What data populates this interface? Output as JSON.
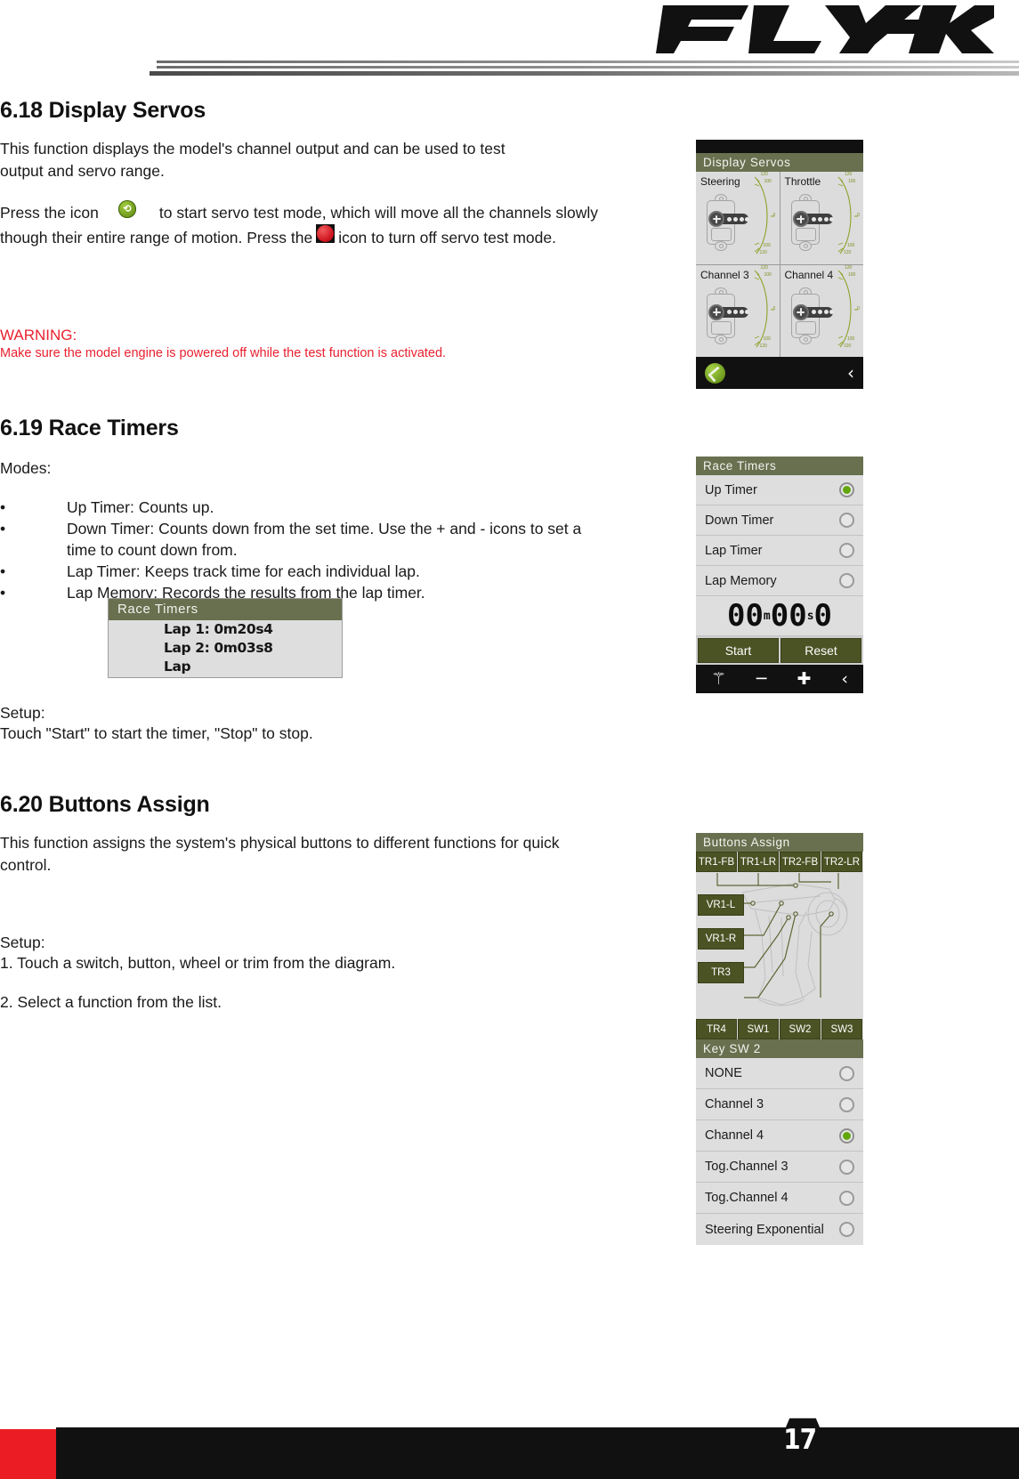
{
  "header": {
    "logo_text": "FLYSKY"
  },
  "sections": {
    "display_servos": {
      "heading": "6.18 Display Servos",
      "para1_line1": "This function displays the model's channel output and can be used to test",
      "para1_line2": "output and servo range.",
      "para2_a": "Press the icon",
      "para2_b": "to start servo test mode, which will move all the channels slowly",
      "para2_c": "though their entire range of motion. Press the",
      "para2_d": "icon to turn off servo test mode.",
      "warning_title": "WARNING:",
      "warning_body": "Make sure the model engine is powered off while the test function is activated."
    },
    "race_timers": {
      "heading": "6.19 Race Timers",
      "modes_label": "Modes:",
      "bullets": [
        {
          "mark": "•",
          "text": "Up Timer: Counts up."
        },
        {
          "mark": "•",
          "text": "Down Timer: Counts down from the set time. Use the + and - icons to set a"
        },
        {
          "mark": "",
          "text": "time to count down from."
        },
        {
          "mark": "•",
          "text": "Lap Timer: Keeps track time for each individual lap."
        },
        {
          "mark": "•",
          "text": "Lap Memory: Records the results from the lap timer."
        }
      ],
      "setup_label": "Setup:",
      "setup_text": "Touch \"Start\" to start the timer, \"Stop\" to stop."
    },
    "buttons_assign": {
      "heading": "6.20 Buttons Assign",
      "para_line1": "This function assigns the system's physical buttons to different functions for quick",
      "para_line2": "control.",
      "setup_label": "Setup:",
      "setup_step1": "1. Touch a switch, button, wheel or trim from the diagram.",
      "setup_step2": "2. Select a function from the list."
    }
  },
  "screens": {
    "display_servos": {
      "title": "Display Servos",
      "cells": [
        {
          "label": "Steering",
          "ticks": [
            "120",
            "100",
            "0",
            "100",
            "120"
          ]
        },
        {
          "label": "Throttle",
          "ticks": [
            "120",
            "100",
            "0",
            "100",
            "120"
          ]
        },
        {
          "label": "Channel 3",
          "ticks": [
            "120",
            "100",
            "0",
            "100",
            "120"
          ]
        },
        {
          "label": "Channel 4",
          "ticks": [
            "120",
            "100",
            "0",
            "100",
            "120"
          ]
        }
      ],
      "footer_icons": [
        "servo-test-start-icon",
        "back-chevron-icon"
      ]
    },
    "race_timers": {
      "title": "Race Timers",
      "options": [
        {
          "label": "Up Timer",
          "selected": true
        },
        {
          "label": "Down Timer",
          "selected": false
        },
        {
          "label": "Lap Timer",
          "selected": false
        },
        {
          "label": "Lap Memory",
          "selected": false
        }
      ],
      "lcd_minutes": "00",
      "lcd_minutes_unit": "m",
      "lcd_seconds": "00",
      "lcd_seconds_unit": "s",
      "lcd_tenths": "0",
      "start_button": "Start",
      "reset_button": "Reset",
      "toolbar_icons": [
        "lap-icon",
        "minus-icon",
        "plus-icon",
        "back-chevron-icon"
      ],
      "toolbar_minus": "─",
      "toolbar_plus": "✚",
      "toolbar_back": "‹"
    },
    "lap_list": {
      "title": "Race Timers",
      "lines": [
        "Lap 1: 0m20s4",
        "Lap 2: 0m03s8",
        "Lap"
      ]
    },
    "buttons_assign": {
      "title": "Buttons Assign",
      "top_tags": [
        "TR1-FB",
        "TR1-LR",
        "TR2-FB",
        "TR2-LR"
      ],
      "left_tags": [
        "VR1-L",
        "VR1-R",
        "TR3"
      ],
      "bottom_tags": [
        "TR4",
        "SW1",
        "SW2",
        "SW3"
      ]
    },
    "key_sw2": {
      "title": "Key SW 2",
      "options": [
        {
          "label": "NONE",
          "selected": false
        },
        {
          "label": "Channel 3",
          "selected": false
        },
        {
          "label": "Channel 4",
          "selected": true
        },
        {
          "label": "Tog.Channel 3",
          "selected": false
        },
        {
          "label": "Tog.Channel 4",
          "selected": false
        },
        {
          "label": "Steering Exponential",
          "selected": false
        }
      ]
    }
  },
  "footer": {
    "page_number": "17"
  },
  "colors": {
    "accent_red": "#ec1c24",
    "screen_olive": "#68704f",
    "button_olive": "#4b5224",
    "warning_red": "#e8212f",
    "led_green": "#62a60a"
  }
}
